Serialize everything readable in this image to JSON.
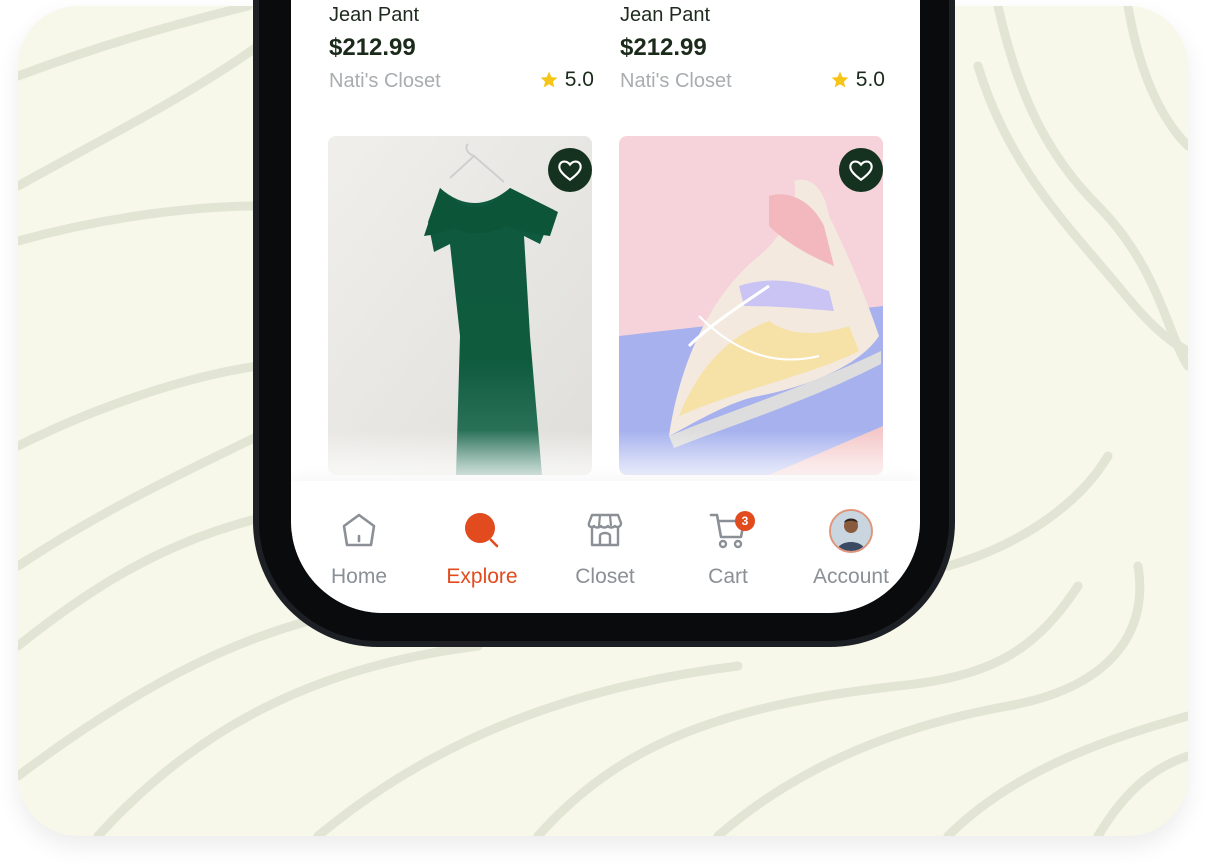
{
  "products_top": [
    {
      "name": "Jean Pant",
      "price": "$212.99",
      "seller": "Nati's Closet",
      "rating": "5.0"
    },
    {
      "name": "Jean Pant",
      "price": "$212.99",
      "seller": "Nati's Closet",
      "rating": "5.0"
    }
  ],
  "products_bottom": [
    {
      "image": "green-dress-photo",
      "favorite_icon": "heart-icon"
    },
    {
      "image": "pastel-sneaker-photo",
      "favorite_icon": "heart-icon"
    }
  ],
  "nav": {
    "items": [
      {
        "label": "Home",
        "icon": "home-icon",
        "active": false
      },
      {
        "label": "Explore",
        "icon": "explore-icon",
        "active": true
      },
      {
        "label": "Closet",
        "icon": "closet-icon",
        "active": false
      },
      {
        "label": "Cart",
        "icon": "cart-icon",
        "active": false,
        "badge": "3"
      },
      {
        "label": "Account",
        "icon": "avatar",
        "active": false
      }
    ]
  },
  "colors": {
    "accent": "#e14b1d",
    "favorite_bg": "#15311f",
    "star": "#f5c518",
    "background": "#f7f8ea"
  }
}
